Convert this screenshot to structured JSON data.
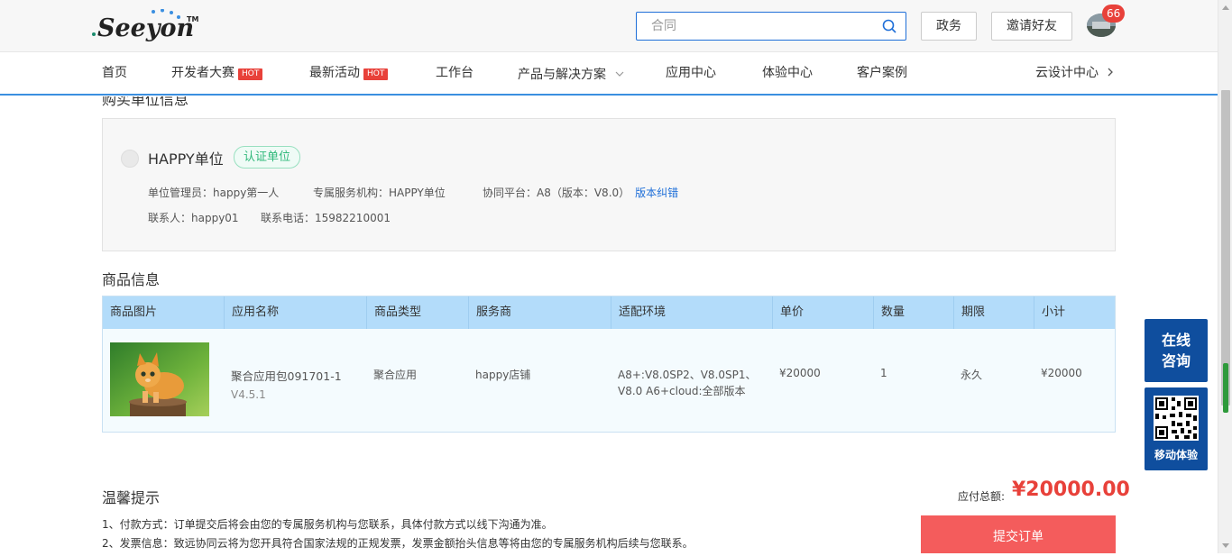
{
  "header": {
    "logo_text": "Seeyon",
    "logo_tm": "TM",
    "search_placeholder": "合同",
    "btn_gov": "政务",
    "btn_invite": "邀请好友",
    "badge_count": "66"
  },
  "nav": {
    "items": [
      "首页",
      "开发者大赛",
      "最新活动",
      "工作台",
      "产品与解决方案",
      "应用中心",
      "体验中心",
      "客户案例",
      "云设计中心"
    ],
    "hot_label": "HOT"
  },
  "buyer": {
    "section_title": "购买单位信息",
    "name": "HAPPY单位",
    "cert": "认证单位",
    "admin": "单位管理员：happy第一人",
    "org": "专属服务机构：HAPPY单位",
    "platform": "协同平台：A8（版本：V8.0）",
    "platform_link": "版本纠错",
    "contact": "联系人：happy01",
    "phone": "联系电话：15982210001"
  },
  "goods": {
    "section_title": "商品信息",
    "columns": [
      "商品图片",
      "应用名称",
      "商品类型",
      "服务商",
      "适配环境",
      "单价",
      "数量",
      "期限",
      "小计"
    ],
    "row": {
      "app_name": "聚合应用包091701-1",
      "version": "V4.5.1",
      "type": "聚合应用",
      "vendor": "happy店铺",
      "env_line1": "A8+:V8.0SP2、V8.0SP1、",
      "env_line2": "V8.0 A6+cloud:全部版本",
      "price": "¥20000",
      "qty": "1",
      "term": "永久",
      "subtotal": "¥20000"
    }
  },
  "tips": {
    "title": "温馨提示",
    "line1": "1、付款方式：订单提交后将会由您的专属服务机构与您联系，具体付款方式以线下沟通为准。",
    "line2": "2、发票信息：致远协同云将为您开具符合国家法规的正规发票，发票金额抬头信息等将由您的专属服务机构后续与您联系。"
  },
  "order": {
    "total_label": "应付总额:",
    "total_value": "¥20000.00",
    "submit": "提交订单"
  },
  "side": {
    "consult_line1": "在线",
    "consult_line2": "咨询",
    "mobile": "移动体验"
  },
  "colors": {
    "brand_blue": "#0f4e9e",
    "link_blue": "#1f6fd8",
    "price_red": "#e8413a",
    "submit_red": "#f45c5c",
    "table_header": "#b3dcfa"
  }
}
